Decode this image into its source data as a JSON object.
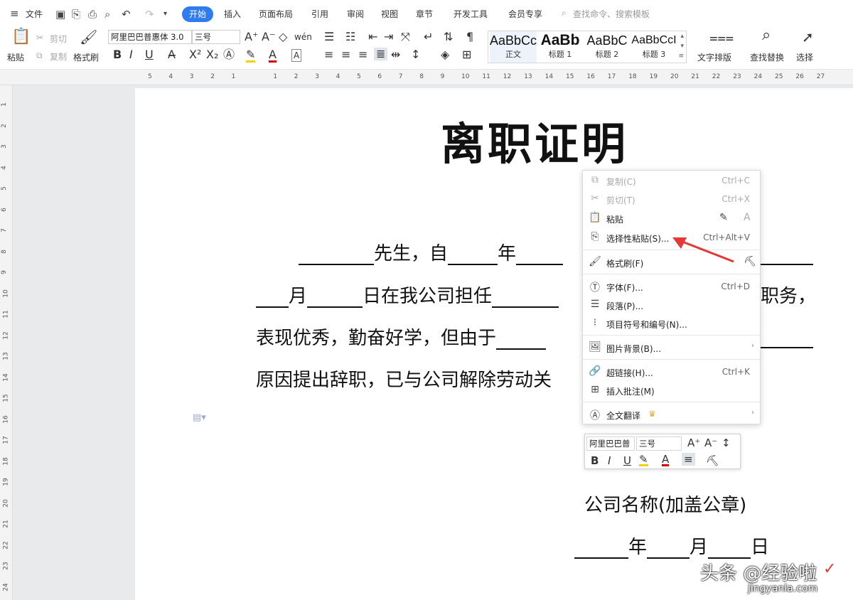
{
  "menu": {
    "file_label": "文件",
    "tabs": [
      "开始",
      "插入",
      "页面布局",
      "引用",
      "审阅",
      "视图",
      "章节",
      "开发工具",
      "会员专享"
    ],
    "search_placeholder": "查找命令、搜索模板"
  },
  "ribbon": {
    "paste": "粘贴",
    "cut": "剪切",
    "copy": "复制",
    "format_painter": "格式刷",
    "font_name": "阿里巴巴普惠体 3.0",
    "font_size": "三号",
    "styles": [
      {
        "sample": "AaBbCc",
        "name": "正文"
      },
      {
        "sample": "AaBb",
        "name": "标题 1"
      },
      {
        "sample": "AaBbC",
        "name": "标题 2"
      },
      {
        "sample": "AaBbCcI",
        "name": "标题 3"
      }
    ],
    "text_layout": "文字排版",
    "find_replace": "查找替换",
    "select": "选择"
  },
  "ruler": {
    "ticks": [
      "5",
      "4",
      "3",
      "2",
      "1",
      "",
      "1",
      "2",
      "3",
      "4",
      "5",
      "6",
      "7",
      "8",
      "9",
      "10",
      "11",
      "12",
      "13",
      "14",
      "15",
      "16",
      "17",
      "18",
      "19",
      "20",
      "21",
      "22",
      "23",
      "24",
      "25",
      "26",
      "27"
    ],
    "vticks": [
      "1",
      "2",
      "3",
      "4",
      "5",
      "6",
      "7",
      "8",
      "9",
      "10",
      "11",
      "12",
      "13",
      "14",
      "15",
      "16",
      "17",
      "18",
      "19",
      "20",
      "21",
      "22",
      "23",
      "24"
    ]
  },
  "document": {
    "title": "离职证明",
    "line1_a": "先生，自",
    "line1_b": "年",
    "line2_a": "月",
    "line2_b": "日在我公司担任",
    "line2_c": "职务，",
    "line3": "表现优秀，勤奋好学，但由于",
    "line4": "原因提出辞职，已与公司解除劳动关",
    "company": "公司名称(加盖公章)",
    "date_year": "年",
    "date_month": "月",
    "date_day": "日"
  },
  "context_menu": {
    "items": [
      {
        "label": "复制(C)",
        "shortcut": "Ctrl+C",
        "disabled": true
      },
      {
        "label": "剪切(T)",
        "shortcut": "Ctrl+X",
        "disabled": true
      },
      {
        "label": "粘贴",
        "shortcut": "",
        "disabled": false
      },
      {
        "label": "选择性粘贴(S)...",
        "shortcut": "Ctrl+Alt+V",
        "disabled": false
      },
      {
        "label": "格式刷(F)",
        "shortcut": "",
        "disabled": false
      },
      {
        "label": "字体(F)...",
        "shortcut": "Ctrl+D",
        "disabled": false
      },
      {
        "label": "段落(P)...",
        "shortcut": "",
        "disabled": false
      },
      {
        "label": "项目符号和编号(N)...",
        "shortcut": "",
        "disabled": false
      },
      {
        "label": "图片背景(B)...",
        "shortcut": "",
        "disabled": false
      },
      {
        "label": "超链接(H)...",
        "shortcut": "Ctrl+K",
        "disabled": false
      },
      {
        "label": "插入批注(M)",
        "shortcut": "",
        "disabled": false
      },
      {
        "label": "全文翻译",
        "shortcut": "",
        "disabled": false
      }
    ]
  },
  "mini_toolbar": {
    "font_name": "阿里巴巴普",
    "font_size": "三号"
  },
  "watermark": {
    "text": "头条 @经验啦",
    "url": "jingyanla.com"
  },
  "colors": {
    "accent": "#2f7bf0",
    "arrow": "#e53935",
    "crown": "#f5a623"
  }
}
